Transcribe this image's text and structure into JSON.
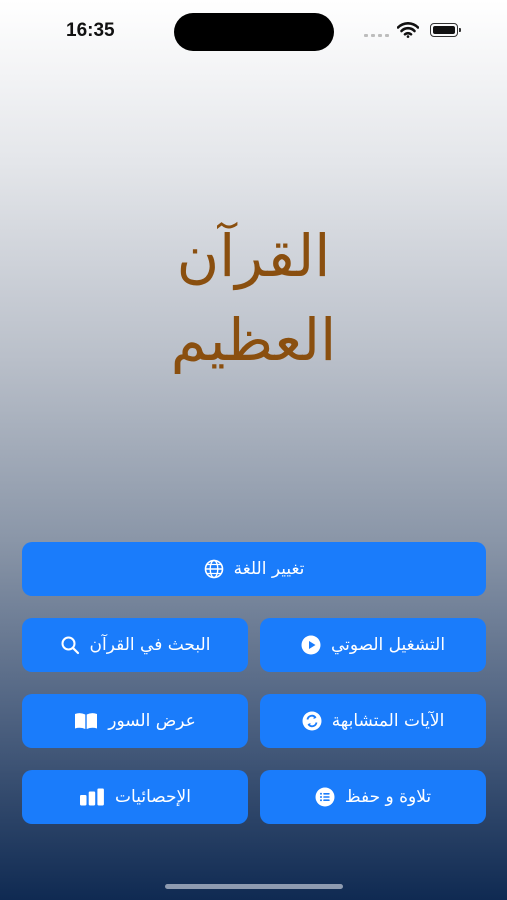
{
  "status_bar": {
    "time": "16:35"
  },
  "app": {
    "title_line1": "القرآن",
    "title_line2": "العظيم"
  },
  "buttons": {
    "change_language": {
      "label": "تغيير اللغة",
      "icon": "globe-icon"
    },
    "audio_playback": {
      "label": "التشغيل الصوتي",
      "icon": "play-circle-icon"
    },
    "search_quran": {
      "label": "البحث في القرآن",
      "icon": "search-icon"
    },
    "similar_verses": {
      "label": "الآيات المتشابهة",
      "icon": "swap-circle-icon"
    },
    "view_surahs": {
      "label": "عرض السور",
      "icon": "book-icon"
    },
    "recite_memorize": {
      "label": "تلاوة و حفظ",
      "icon": "list-circle-icon"
    },
    "statistics": {
      "label": "الإحصائيات",
      "icon": "bar-chart-icon"
    }
  },
  "colors": {
    "button_bg": "#1a7cfb",
    "title_color": "#8a4f0f",
    "gradient_top": "#ffffff",
    "gradient_bottom": "#0f2a52"
  }
}
